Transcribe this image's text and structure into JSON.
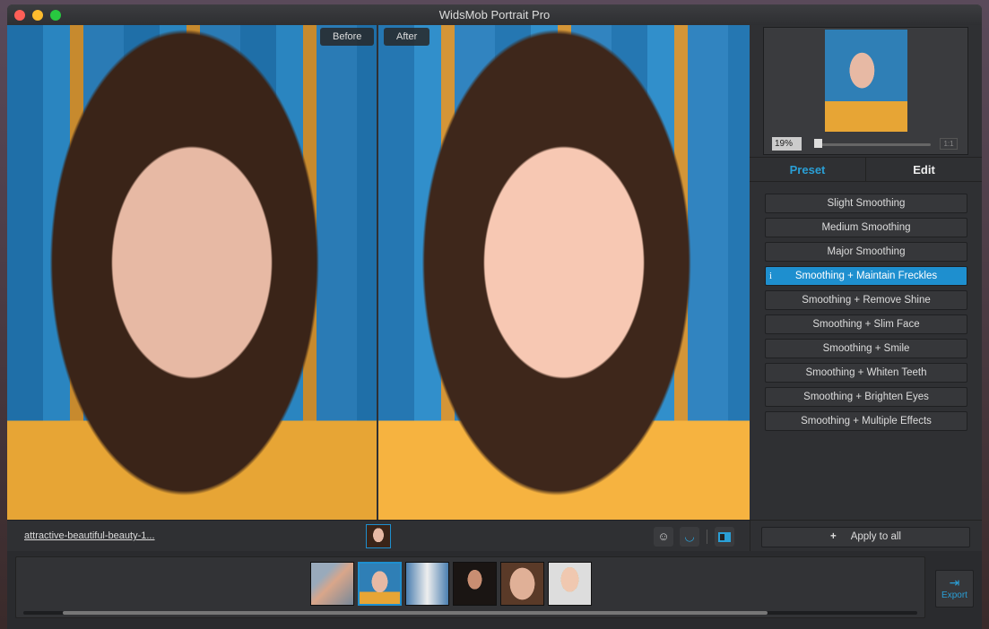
{
  "window": {
    "title": "WidsMob Portrait Pro"
  },
  "compare": {
    "before_label": "Before",
    "after_label": "After"
  },
  "navigator": {
    "zoom": "19%",
    "zoom_slider_value": 0.0,
    "fit_label": "1:1"
  },
  "tabs": [
    {
      "label": "Preset",
      "active": true
    },
    {
      "label": "Edit",
      "active": false
    }
  ],
  "presets": [
    "Slight Smoothing",
    "Medium Smoothing",
    "Major Smoothing",
    "Smoothing + Maintain Freckles",
    "Smoothing + Remove Shine",
    "Smoothing + Slim Face",
    "Smoothing + Smile",
    "Smoothing + Whiten Teeth",
    "Smoothing + Brighten Eyes",
    "Smoothing + Multiple Effects"
  ],
  "selected_preset": "Smoothing + Maintain Freckles",
  "info_icon": "i",
  "bottom": {
    "filename": "attractive-beautiful-beauty-1...",
    "apply_all": "Apply to all",
    "apply_icon": "+"
  },
  "export": {
    "label": "Export"
  },
  "colors": {
    "accent": "#1e8fcf"
  }
}
